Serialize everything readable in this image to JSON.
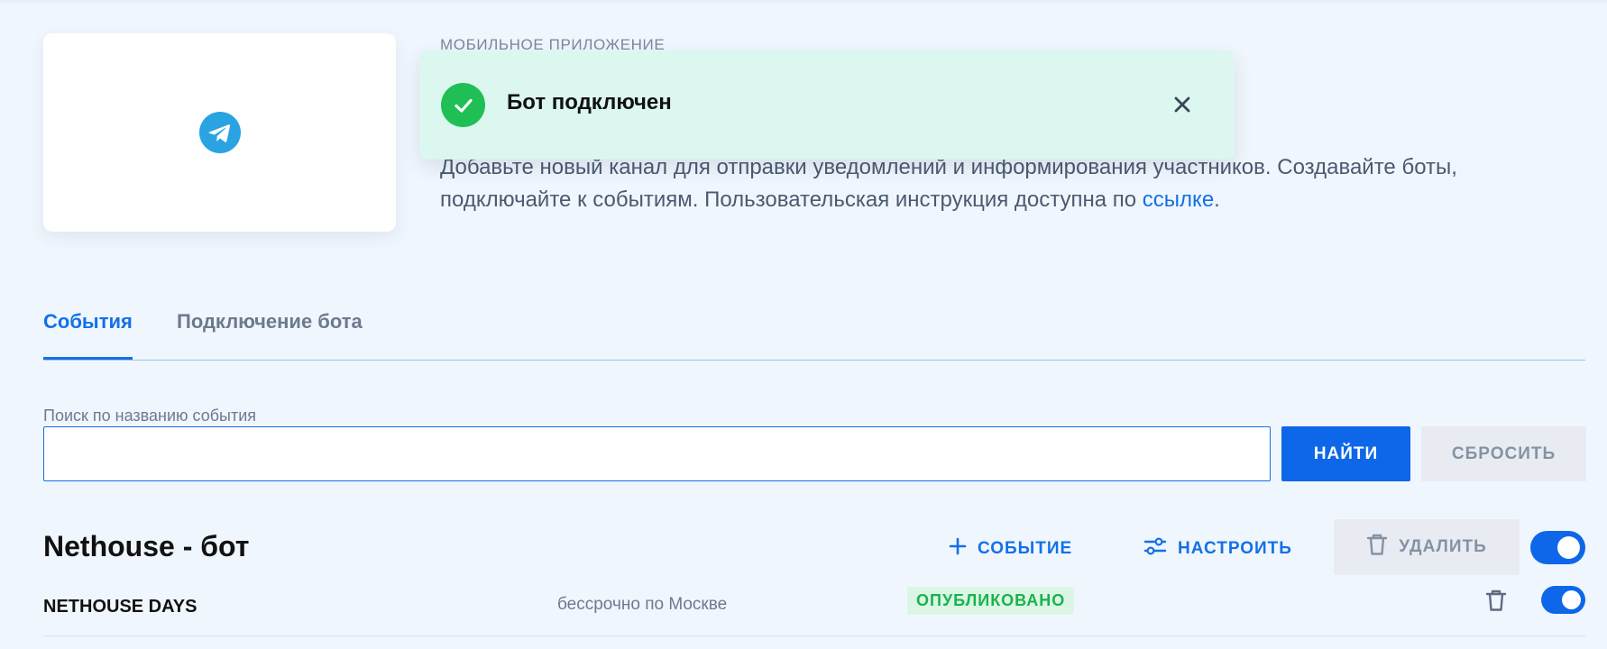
{
  "header": {
    "app_label": "МОБИЛЬНОЕ ПРИЛОЖЕНИЕ",
    "logo_icon": "telegram-icon",
    "description_text": "Добавьте новый канал для отправки уведомлений и информирования участников. Создавайте боты, подключайте к событиям. Пользовательская инструкция доступна по ",
    "description_link": "ссылке",
    "description_end": "."
  },
  "toast": {
    "message": "Бот подключен",
    "icon": "check-circle-icon",
    "close_icon": "close-icon"
  },
  "tabs": [
    {
      "label": "События",
      "active": true
    },
    {
      "label": "Подключение бота",
      "active": false
    }
  ],
  "search": {
    "label": "Поиск по названию события",
    "value": "",
    "placeholder": "",
    "find_label": "НАЙТИ",
    "reset_label": "СБРОСИТЬ"
  },
  "bot": {
    "title": "Nethouse - бот",
    "add_event_label": "СОБЫТИЕ",
    "configure_label": "НАСТРОИТЬ",
    "delete_label": "УДАЛИТЬ",
    "enabled": true
  },
  "events": [
    {
      "name": "NETHOUSE DAYS",
      "date": "бессрочно по Москве",
      "status": "ОПУБЛИКОВАНО",
      "enabled": true
    }
  ],
  "colors": {
    "accent": "#0e67e8",
    "success": "#1fbf55",
    "toast_bg": "#dbf7f0",
    "page_bg": "#f0f6fd"
  }
}
